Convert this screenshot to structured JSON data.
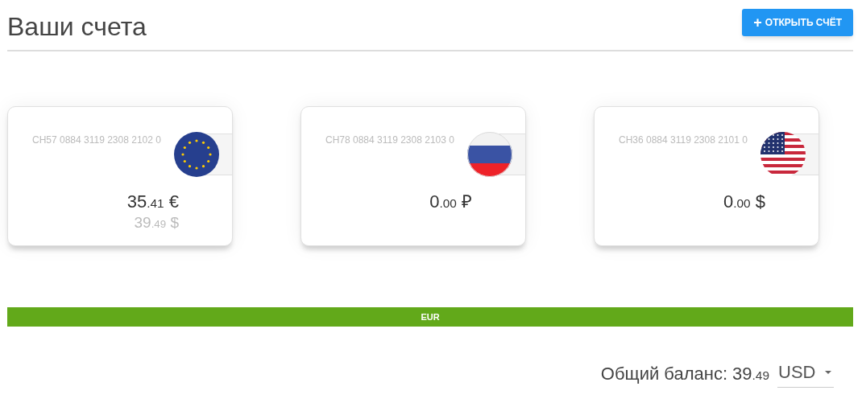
{
  "title": "Ваши счета",
  "open_button": {
    "icon": "+",
    "label": "ОТКРЫТЬ СЧЁТ"
  },
  "accounts": [
    {
      "number": "CH57 0884 3119 2308 2102 0",
      "kind": "eu",
      "amount": {
        "whole": "35",
        "fraction": ".41",
        "currency": "€"
      },
      "converted": {
        "whole": "39",
        "fraction": ".49",
        "currency": "$"
      }
    },
    {
      "number": "CH78 0884 3119 2308 2103 0",
      "kind": "ru",
      "amount": {
        "whole": "0",
        "fraction": ".00",
        "currency": "₽"
      }
    },
    {
      "number": "CH36 0884 3119 2308 2101 0",
      "kind": "us",
      "amount": {
        "whole": "0",
        "fraction": ".00",
        "currency": "$"
      }
    }
  ],
  "currency_bar": {
    "label": "EUR"
  },
  "total": {
    "label": "Общий баланс:",
    "whole": "39",
    "fraction": ".49",
    "currency": "USD"
  }
}
